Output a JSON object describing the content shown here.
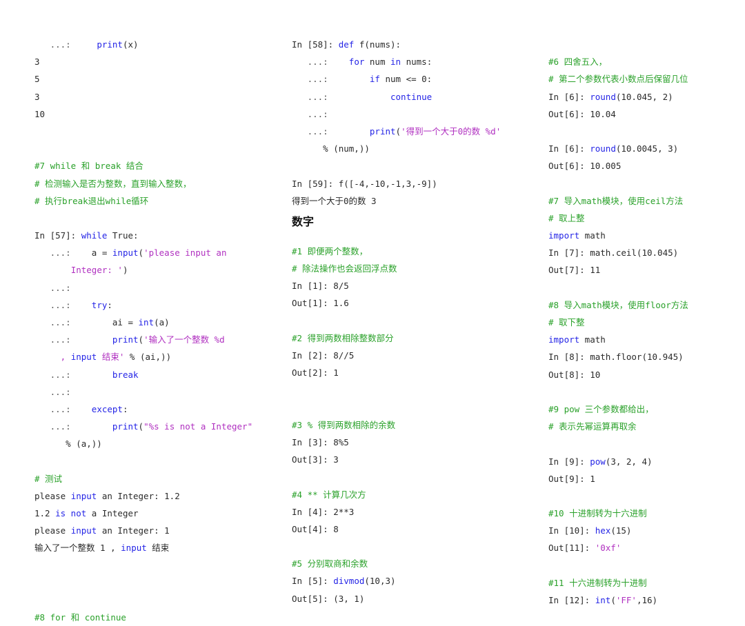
{
  "columns": [
    {
      "lines": [
        {
          "parts": [
            {
              "t": "   ...:     ",
              "c": "dots"
            },
            {
              "t": "print",
              "c": "kw"
            },
            {
              "t": "(x)",
              "c": ""
            }
          ]
        },
        {
          "parts": [
            {
              "t": "3",
              "c": ""
            }
          ]
        },
        {
          "parts": [
            {
              "t": "5",
              "c": ""
            }
          ]
        },
        {
          "parts": [
            {
              "t": "3",
              "c": ""
            }
          ]
        },
        {
          "parts": [
            {
              "t": "10",
              "c": ""
            }
          ]
        },
        {
          "gap": true
        },
        {
          "gap": true
        },
        {
          "parts": [
            {
              "t": "#7 while 和 break 结合",
              "c": "cmt"
            }
          ]
        },
        {
          "parts": [
            {
              "t": "# 检测输入是否为整数，直到输入整数，",
              "c": "cmt"
            }
          ]
        },
        {
          "parts": [
            {
              "t": "# 执行break退出while循环",
              "c": "cmt"
            }
          ]
        },
        {
          "gap": true
        },
        {
          "parts": [
            {
              "t": "In [57]: ",
              "c": ""
            },
            {
              "t": "while",
              "c": "kw"
            },
            {
              "t": " True:",
              "c": ""
            }
          ]
        },
        {
          "parts": [
            {
              "t": "   ...:    ",
              "c": "dots"
            },
            {
              "t": "a = ",
              "c": ""
            },
            {
              "t": "input",
              "c": "kw"
            },
            {
              "t": "(",
              "c": ""
            },
            {
              "t": "'please input an",
              "c": "str"
            }
          ]
        },
        {
          "parts": [
            {
              "t": "       ",
              "c": ""
            },
            {
              "t": "Integer: '",
              "c": "str"
            },
            {
              "t": ")",
              "c": ""
            }
          ]
        },
        {
          "parts": [
            {
              "t": "   ...:",
              "c": "dots"
            }
          ]
        },
        {
          "parts": [
            {
              "t": "   ...:    ",
              "c": "dots"
            },
            {
              "t": "try",
              "c": "kw"
            },
            {
              "t": ":",
              "c": ""
            }
          ]
        },
        {
          "parts": [
            {
              "t": "   ...:        ",
              "c": "dots"
            },
            {
              "t": "ai = ",
              "c": ""
            },
            {
              "t": "int",
              "c": "kw"
            },
            {
              "t": "(a)",
              "c": ""
            }
          ]
        },
        {
          "parts": [
            {
              "t": "   ...:        ",
              "c": "dots"
            },
            {
              "t": "print",
              "c": "kw"
            },
            {
              "t": "(",
              "c": ""
            },
            {
              "t": "'输入了一个整数 %d",
              "c": "str"
            }
          ]
        },
        {
          "parts": [
            {
              "t": "     , ",
              "c": "str"
            },
            {
              "t": "input",
              "c": "kw"
            },
            {
              "t": " 结束'",
              "c": "str"
            },
            {
              "t": " % (ai,))",
              "c": ""
            }
          ]
        },
        {
          "parts": [
            {
              "t": "   ...:        ",
              "c": "dots"
            },
            {
              "t": "break",
              "c": "kw"
            }
          ]
        },
        {
          "parts": [
            {
              "t": "   ...:",
              "c": "dots"
            }
          ]
        },
        {
          "parts": [
            {
              "t": "   ...:    ",
              "c": "dots"
            },
            {
              "t": "except",
              "c": "kw"
            },
            {
              "t": ":",
              "c": ""
            }
          ]
        },
        {
          "parts": [
            {
              "t": "   ...:        ",
              "c": "dots"
            },
            {
              "t": "print",
              "c": "kw"
            },
            {
              "t": "(",
              "c": ""
            },
            {
              "t": "\"%s is not a Integer\"",
              "c": "str"
            }
          ]
        },
        {
          "parts": [
            {
              "t": "      % (a,))",
              "c": ""
            }
          ]
        },
        {
          "gap": true
        },
        {
          "parts": [
            {
              "t": "# 测试",
              "c": "cmt"
            }
          ]
        },
        {
          "parts": [
            {
              "t": "please ",
              "c": ""
            },
            {
              "t": "input",
              "c": "kw"
            },
            {
              "t": " an Integer: 1.2",
              "c": ""
            }
          ]
        },
        {
          "parts": [
            {
              "t": "1.2 ",
              "c": ""
            },
            {
              "t": "is not",
              "c": "kw"
            },
            {
              "t": " a Integer",
              "c": ""
            }
          ]
        },
        {
          "parts": [
            {
              "t": "please ",
              "c": ""
            },
            {
              "t": "input",
              "c": "kw"
            },
            {
              "t": " an Integer: 1",
              "c": ""
            }
          ]
        },
        {
          "parts": [
            {
              "t": "输入了一个整数 1 , ",
              "c": ""
            },
            {
              "t": "input",
              "c": "kw"
            },
            {
              "t": " 结束",
              "c": ""
            }
          ]
        },
        {
          "gap": true
        },
        {
          "gap": true
        },
        {
          "gap": true
        },
        {
          "parts": [
            {
              "t": "#8 for 和 continue",
              "c": "cmt"
            }
          ]
        }
      ]
    },
    {
      "lines": [
        {
          "parts": [
            {
              "t": "In [58]: ",
              "c": ""
            },
            {
              "t": "def",
              "c": "kw"
            },
            {
              "t": " f(nums):",
              "c": ""
            }
          ]
        },
        {
          "parts": [
            {
              "t": "   ...:    ",
              "c": "dots"
            },
            {
              "t": "for",
              "c": "kw"
            },
            {
              "t": " num ",
              "c": ""
            },
            {
              "t": "in",
              "c": "kw"
            },
            {
              "t": " nums:",
              "c": ""
            }
          ]
        },
        {
          "parts": [
            {
              "t": "   ...:        ",
              "c": "dots"
            },
            {
              "t": "if",
              "c": "kw"
            },
            {
              "t": " num <= 0:",
              "c": ""
            }
          ]
        },
        {
          "parts": [
            {
              "t": "   ...:            ",
              "c": "dots"
            },
            {
              "t": "continue",
              "c": "kw"
            }
          ]
        },
        {
          "parts": [
            {
              "t": "   ...:",
              "c": "dots"
            }
          ]
        },
        {
          "parts": [
            {
              "t": "   ...:        ",
              "c": "dots"
            },
            {
              "t": "print",
              "c": "kw"
            },
            {
              "t": "(",
              "c": ""
            },
            {
              "t": "'得到一个大于0的数 %d'",
              "c": "str"
            }
          ]
        },
        {
          "parts": [
            {
              "t": "      % (num,))",
              "c": ""
            }
          ]
        },
        {
          "gap": true
        },
        {
          "parts": [
            {
              "t": "In [59]: f([-4,-10,-1,3,-9])",
              "c": ""
            }
          ]
        },
        {
          "parts": [
            {
              "t": "得到一个大于0的数 3",
              "c": ""
            }
          ]
        },
        {
          "heading": "数字"
        },
        {
          "gap_h": true
        },
        {
          "parts": [
            {
              "t": "#1 即便两个整数，",
              "c": "cmt"
            }
          ]
        },
        {
          "parts": [
            {
              "t": "# 除法操作也会返回浮点数",
              "c": "cmt"
            }
          ]
        },
        {
          "parts": [
            {
              "t": "In [1]: 8/5",
              "c": ""
            }
          ]
        },
        {
          "parts": [
            {
              "t": "Out[1]: 1.6",
              "c": ""
            }
          ]
        },
        {
          "gap": true
        },
        {
          "parts": [
            {
              "t": "#2 得到两数相除整数部分",
              "c": "cmt"
            }
          ]
        },
        {
          "parts": [
            {
              "t": "In [2]: 8//5",
              "c": ""
            }
          ]
        },
        {
          "parts": [
            {
              "t": "Out[2]: 1",
              "c": ""
            }
          ]
        },
        {
          "gap": true
        },
        {
          "gap": true
        },
        {
          "parts": [
            {
              "t": "#3 % 得到两数相除的余数",
              "c": "cmt"
            }
          ]
        },
        {
          "parts": [
            {
              "t": "In [3]: 8%5",
              "c": ""
            }
          ]
        },
        {
          "parts": [
            {
              "t": "Out[3]: 3",
              "c": ""
            }
          ]
        },
        {
          "gap": true
        },
        {
          "parts": [
            {
              "t": "#4 ** 计算几次方",
              "c": "cmt"
            }
          ]
        },
        {
          "parts": [
            {
              "t": "In [4]: 2**3",
              "c": ""
            }
          ]
        },
        {
          "parts": [
            {
              "t": "Out[4]: 8",
              "c": ""
            }
          ]
        },
        {
          "gap": true
        },
        {
          "parts": [
            {
              "t": "#5 分别取商和余数",
              "c": "cmt"
            }
          ]
        },
        {
          "parts": [
            {
              "t": "In [5]: ",
              "c": ""
            },
            {
              "t": "divmod",
              "c": "kw"
            },
            {
              "t": "(10,3)",
              "c": ""
            }
          ]
        },
        {
          "parts": [
            {
              "t": "Out[5]: (3, 1)",
              "c": ""
            }
          ]
        }
      ]
    },
    {
      "lines": [
        {
          "gap": true
        },
        {
          "parts": [
            {
              "t": "#6 四舍五入，",
              "c": "cmt"
            }
          ]
        },
        {
          "parts": [
            {
              "t": "# 第二个参数代表小数点后保留几位",
              "c": "cmt"
            }
          ]
        },
        {
          "parts": [
            {
              "t": "In [6]: ",
              "c": ""
            },
            {
              "t": "round",
              "c": "kw"
            },
            {
              "t": "(10.045, 2)",
              "c": ""
            }
          ]
        },
        {
          "parts": [
            {
              "t": "Out[6]: 10.04",
              "c": ""
            }
          ]
        },
        {
          "gap": true
        },
        {
          "parts": [
            {
              "t": "In [6]: ",
              "c": ""
            },
            {
              "t": "round",
              "c": "kw"
            },
            {
              "t": "(10.0045, 3)",
              "c": ""
            }
          ]
        },
        {
          "parts": [
            {
              "t": "Out[6]: 10.005",
              "c": ""
            }
          ]
        },
        {
          "gap": true
        },
        {
          "parts": [
            {
              "t": "#7 导入math模块，使用ceil方法",
              "c": "cmt"
            }
          ]
        },
        {
          "parts": [
            {
              "t": "# 取上整",
              "c": "cmt"
            }
          ]
        },
        {
          "parts": [
            {
              "t": "import",
              "c": "kw"
            },
            {
              "t": " math",
              "c": ""
            }
          ]
        },
        {
          "parts": [
            {
              "t": "In [7]: math.ceil(10.045)",
              "c": ""
            }
          ]
        },
        {
          "parts": [
            {
              "t": "Out[7]: 11",
              "c": ""
            }
          ]
        },
        {
          "gap": true
        },
        {
          "parts": [
            {
              "t": "#8 导入math模块，使用floor方法",
              "c": "cmt"
            }
          ]
        },
        {
          "parts": [
            {
              "t": "# 取下整",
              "c": "cmt"
            }
          ]
        },
        {
          "parts": [
            {
              "t": "import",
              "c": "kw"
            },
            {
              "t": " math",
              "c": ""
            }
          ]
        },
        {
          "parts": [
            {
              "t": "In [8]: math.floor(10.945)",
              "c": ""
            }
          ]
        },
        {
          "parts": [
            {
              "t": "Out[8]: 10",
              "c": ""
            }
          ]
        },
        {
          "gap": true
        },
        {
          "parts": [
            {
              "t": "#9 pow 三个参数都给出，",
              "c": "cmt"
            }
          ]
        },
        {
          "parts": [
            {
              "t": "# 表示先幂运算再取余",
              "c": "cmt"
            }
          ]
        },
        {
          "gap": true
        },
        {
          "parts": [
            {
              "t": "In [9]: ",
              "c": ""
            },
            {
              "t": "pow",
              "c": "kw"
            },
            {
              "t": "(3, 2, 4)",
              "c": ""
            }
          ]
        },
        {
          "parts": [
            {
              "t": "Out[9]: 1",
              "c": ""
            }
          ]
        },
        {
          "gap": true
        },
        {
          "parts": [
            {
              "t": "#10 十进制转为十六进制",
              "c": "cmt"
            }
          ]
        },
        {
          "parts": [
            {
              "t": "In [10]: ",
              "c": ""
            },
            {
              "t": "hex",
              "c": "kw"
            },
            {
              "t": "(15)",
              "c": ""
            }
          ]
        },
        {
          "parts": [
            {
              "t": "Out[11]: ",
              "c": ""
            },
            {
              "t": "'0xf'",
              "c": "str"
            }
          ]
        },
        {
          "gap": true
        },
        {
          "parts": [
            {
              "t": "#11 十六进制转为十进制",
              "c": "cmt"
            }
          ]
        },
        {
          "parts": [
            {
              "t": "In [12]: ",
              "c": ""
            },
            {
              "t": "int",
              "c": "kw"
            },
            {
              "t": "(",
              "c": ""
            },
            {
              "t": "'FF'",
              "c": "str"
            },
            {
              "t": ",16)",
              "c": ""
            }
          ]
        }
      ]
    }
  ]
}
